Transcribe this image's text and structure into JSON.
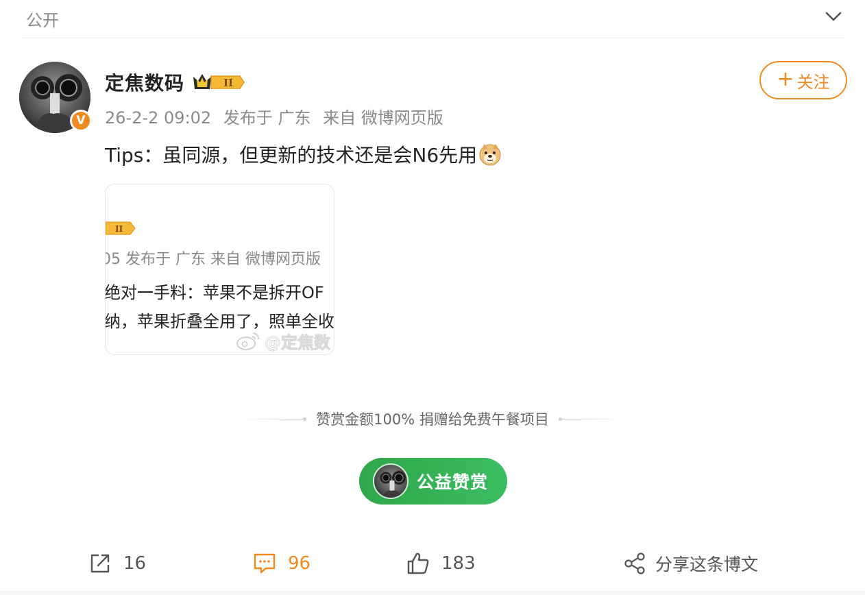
{
  "header": {
    "visibility": "公开",
    "collapse_icon": "chevron-down-icon"
  },
  "author": {
    "name": "定焦数码",
    "verified_mark": "V",
    "level_badge": "II",
    "follow_plus": "+",
    "follow_label": "关注",
    "accent_color": "#f08a1c"
  },
  "meta": {
    "time": "26-2-2 09:02",
    "location": "发布于 广东",
    "source": "来自 微博网页版"
  },
  "post": {
    "text": "Tips：虽同源，但更新的技术还是会N6先用",
    "emoji": "doge-emoji"
  },
  "attached_image": {
    "level_badge": "II",
    "meta": "05 发布于 广东 来自 微博网页版",
    "line1": "绝对一手料：苹果不是拆开OF",
    "line2": "纳，苹果折叠全用了，照单全收",
    "watermark": "@定焦数"
  },
  "reward": {
    "caption": "赞赏金额100% 捐赠给免费午餐项目",
    "button_label": "公益赞赏",
    "button_color": "#35b355"
  },
  "actions": {
    "repost_count": "16",
    "comment_count": "96",
    "like_count": "183",
    "share_label": "分享这条博文"
  }
}
